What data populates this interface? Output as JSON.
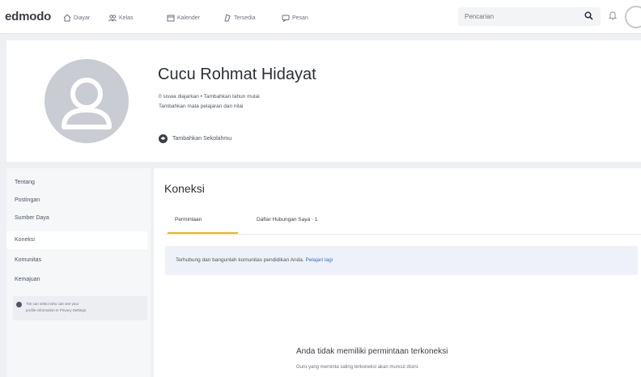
{
  "app": {
    "logo": "edmodo"
  },
  "topnav": [
    {
      "label": "Diayar",
      "icon": "home-icon"
    },
    {
      "label": "Kelas",
      "icon": "classes-icon"
    },
    {
      "label": "Kalender",
      "icon": "calendar-icon"
    },
    {
      "label": "Tersedia",
      "icon": "backpack-icon"
    },
    {
      "label": "Pesan",
      "icon": "messages-icon"
    }
  ],
  "search": {
    "placeholder": "Pencarian"
  },
  "profile": {
    "name": "Cucu Rohmat Hidayat",
    "line1": "0 siswa diajarkan  •  Tambahkan tahun mulai",
    "line2": "Tambahkan mata pelajaran dan nilai",
    "school_link": "Tambahkan Sekolahmu"
  },
  "sidebar": {
    "items": [
      {
        "label": "Tentang",
        "active": false
      },
      {
        "label": "Postingan",
        "active": false
      },
      {
        "label": "Sumber Daya",
        "active": false
      },
      {
        "label": "Koneksi",
        "active": true
      },
      {
        "label": "Komunitas",
        "active": false
      },
      {
        "label": "Kemajuan",
        "active": false
      }
    ],
    "note_line1": "Tim can select who can see your",
    "note_line2": "profile information in Privacy Settings."
  },
  "main": {
    "title": "Koneksi",
    "tabs": [
      {
        "label": "Permintaan",
        "active": true
      },
      {
        "label": "Daftar Hubungan Saya · 1",
        "active": false
      }
    ],
    "banner_text": "Terhubung dan bangunlah komunitas pendidikan Anda.",
    "banner_link": "Pelajari lagi",
    "empty_title": "Anda tidak memiliki permintaan terkoneksi",
    "empty_sub": "Guru yang meminta saling terkoneksi akan muncul disini."
  },
  "colors": {
    "accent": "#f2b705",
    "link": "#2f6fd6"
  }
}
